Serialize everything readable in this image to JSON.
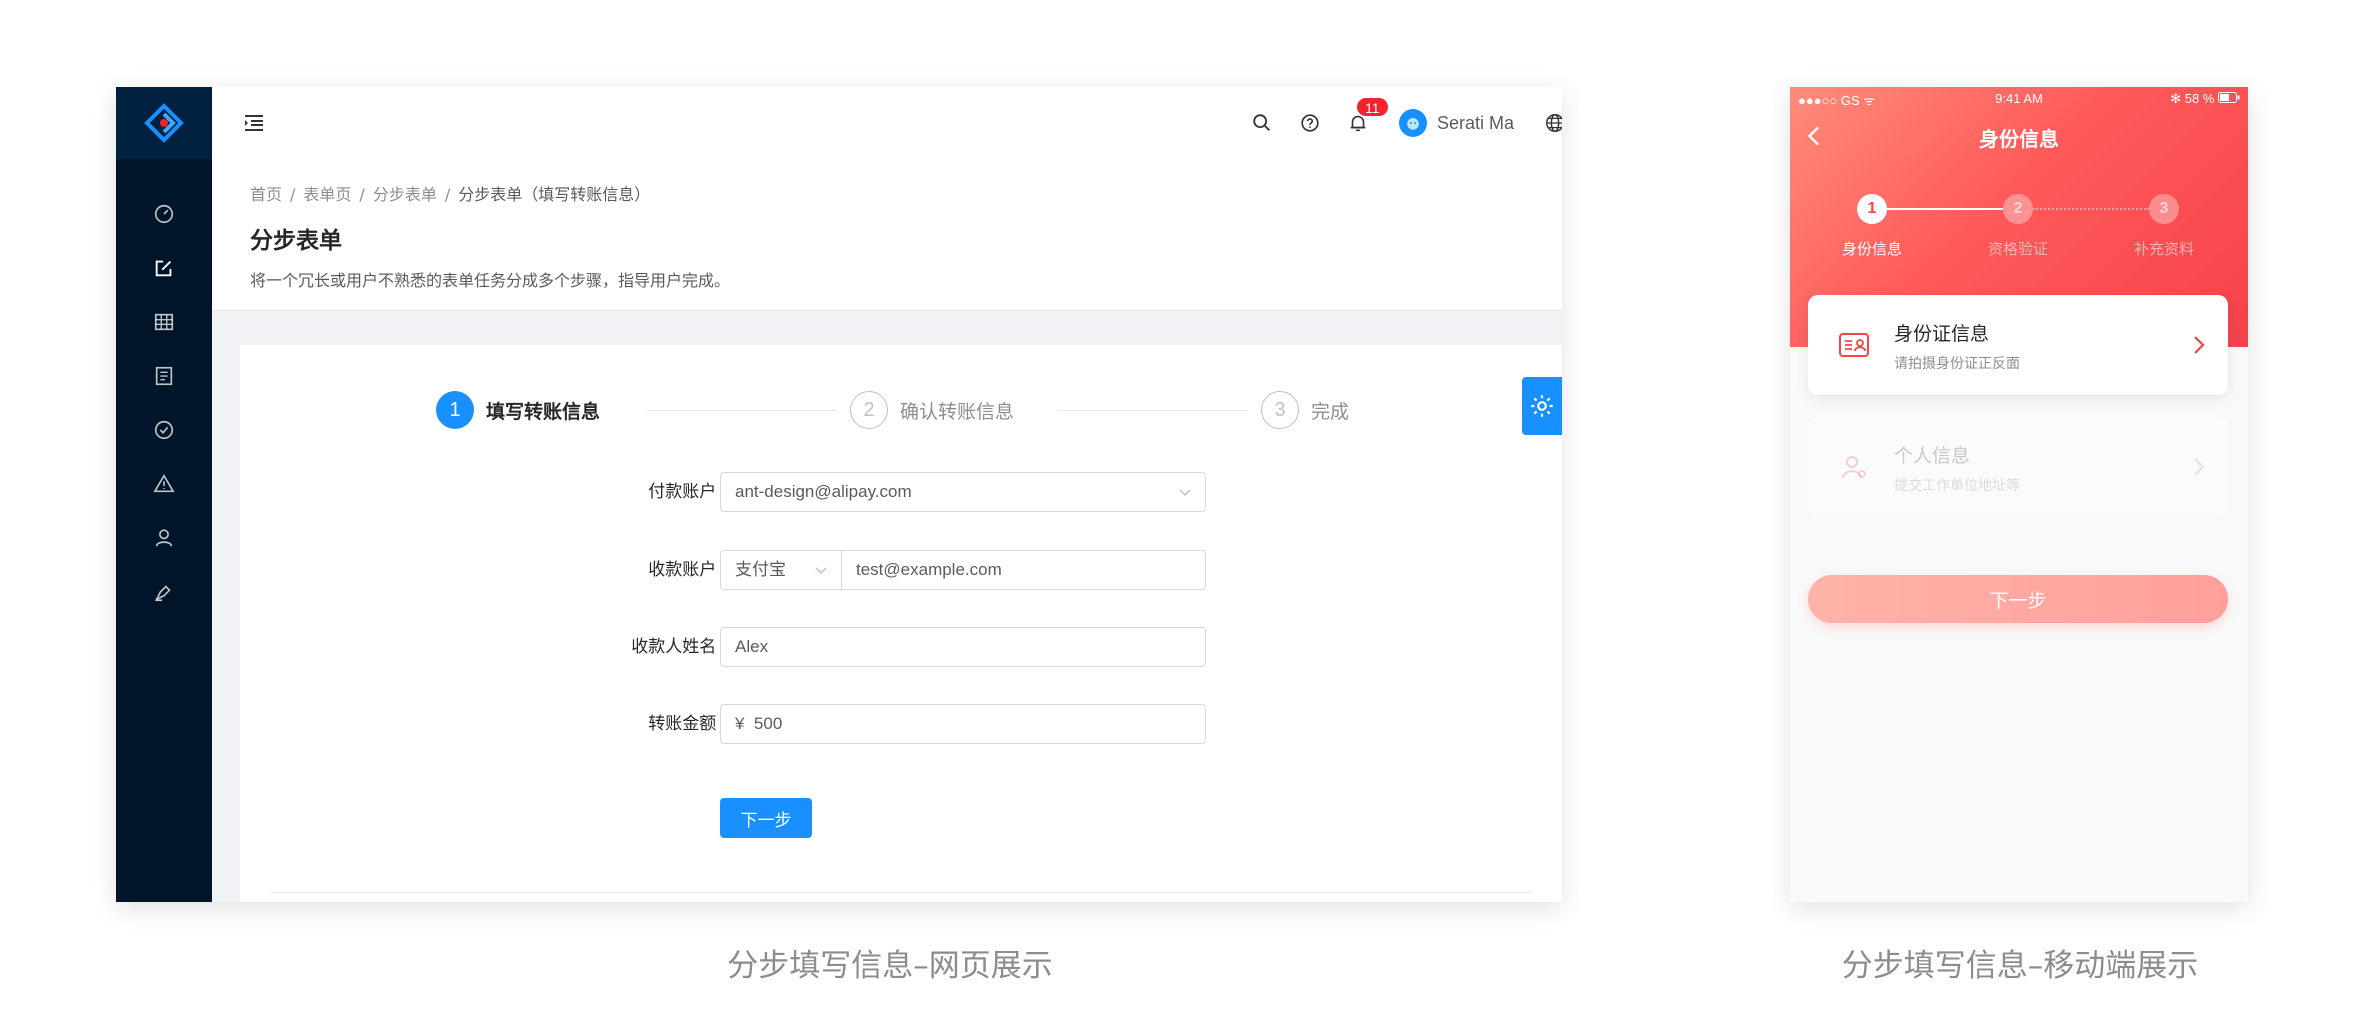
{
  "web": {
    "sider": {
      "menu_icons": [
        "dashboard-icon",
        "form-icon",
        "table-icon",
        "profile-icon",
        "result-icon",
        "exception-icon",
        "user-icon",
        "editor-icon"
      ]
    },
    "header": {
      "notification_count": "11",
      "user_name": "Serati Ma"
    },
    "breadcrumb": [
      "首页",
      "表单页",
      "分步表单",
      "分步表单（填写转账信息）"
    ],
    "breadcrumb_sep": "/",
    "page_title": "分步表单",
    "page_desc": "将一个冗长或用户不熟悉的表单任务分成多个步骤，指导用户完成。",
    "steps": [
      {
        "num": "1",
        "title": "填写转账信息",
        "status": "active"
      },
      {
        "num": "2",
        "title": "确认转账信息",
        "status": "wait"
      },
      {
        "num": "3",
        "title": "完成",
        "status": "wait"
      }
    ],
    "form": {
      "pay_account_label": "付款账户",
      "pay_account_value": "ant-design@alipay.com",
      "receive_account_label": "收款账户",
      "receive_method_value": "支付宝",
      "receive_account_value": "test@example.com",
      "receiver_name_label": "收款人姓名",
      "receiver_name_value": "Alex",
      "amount_label": "转账金额",
      "amount_prefix": "¥",
      "amount_value": "500",
      "next_button": "下一步"
    },
    "accent_color": "#1890ff"
  },
  "mobile": {
    "status_bar": {
      "carrier": "●●●○○ GS ᯤ",
      "time": "9:41 AM",
      "battery": "✻ 58 %"
    },
    "title": "身份信息",
    "steps": [
      {
        "num": "1",
        "label": "身份信息",
        "status": "active"
      },
      {
        "num": "2",
        "label": "资格验证",
        "status": "wait"
      },
      {
        "num": "3",
        "label": "补充资料",
        "status": "wait"
      }
    ],
    "cards": [
      {
        "title": "身份证信息",
        "subtitle": "请拍摄身份证正反面",
        "icon": "id-card-icon",
        "enabled": true
      },
      {
        "title": "个人信息",
        "subtitle": "提交工作单位地址等",
        "icon": "person-icon",
        "enabled": false
      }
    ],
    "next_button": "下一步",
    "accent_color": "#f5424b"
  },
  "captions": {
    "web": "分步填写信息–网页展示",
    "mobile": "分步填写信息–移动端展示"
  }
}
